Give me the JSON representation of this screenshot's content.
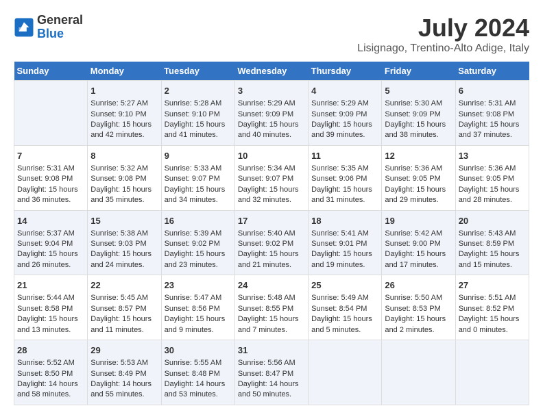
{
  "logo": {
    "line1": "General",
    "line2": "Blue"
  },
  "title": "July 2024",
  "subtitle": "Lisignago, Trentino-Alto Adige, Italy",
  "days_of_week": [
    "Sunday",
    "Monday",
    "Tuesday",
    "Wednesday",
    "Thursday",
    "Friday",
    "Saturday"
  ],
  "weeks": [
    [
      {
        "day": "",
        "content": ""
      },
      {
        "day": "1",
        "content": "Sunrise: 5:27 AM\nSunset: 9:10 PM\nDaylight: 15 hours\nand 42 minutes."
      },
      {
        "day": "2",
        "content": "Sunrise: 5:28 AM\nSunset: 9:10 PM\nDaylight: 15 hours\nand 41 minutes."
      },
      {
        "day": "3",
        "content": "Sunrise: 5:29 AM\nSunset: 9:09 PM\nDaylight: 15 hours\nand 40 minutes."
      },
      {
        "day": "4",
        "content": "Sunrise: 5:29 AM\nSunset: 9:09 PM\nDaylight: 15 hours\nand 39 minutes."
      },
      {
        "day": "5",
        "content": "Sunrise: 5:30 AM\nSunset: 9:09 PM\nDaylight: 15 hours\nand 38 minutes."
      },
      {
        "day": "6",
        "content": "Sunrise: 5:31 AM\nSunset: 9:08 PM\nDaylight: 15 hours\nand 37 minutes."
      }
    ],
    [
      {
        "day": "7",
        "content": "Sunrise: 5:31 AM\nSunset: 9:08 PM\nDaylight: 15 hours\nand 36 minutes."
      },
      {
        "day": "8",
        "content": "Sunrise: 5:32 AM\nSunset: 9:08 PM\nDaylight: 15 hours\nand 35 minutes."
      },
      {
        "day": "9",
        "content": "Sunrise: 5:33 AM\nSunset: 9:07 PM\nDaylight: 15 hours\nand 34 minutes."
      },
      {
        "day": "10",
        "content": "Sunrise: 5:34 AM\nSunset: 9:07 PM\nDaylight: 15 hours\nand 32 minutes."
      },
      {
        "day": "11",
        "content": "Sunrise: 5:35 AM\nSunset: 9:06 PM\nDaylight: 15 hours\nand 31 minutes."
      },
      {
        "day": "12",
        "content": "Sunrise: 5:36 AM\nSunset: 9:05 PM\nDaylight: 15 hours\nand 29 minutes."
      },
      {
        "day": "13",
        "content": "Sunrise: 5:36 AM\nSunset: 9:05 PM\nDaylight: 15 hours\nand 28 minutes."
      }
    ],
    [
      {
        "day": "14",
        "content": "Sunrise: 5:37 AM\nSunset: 9:04 PM\nDaylight: 15 hours\nand 26 minutes."
      },
      {
        "day": "15",
        "content": "Sunrise: 5:38 AM\nSunset: 9:03 PM\nDaylight: 15 hours\nand 24 minutes."
      },
      {
        "day": "16",
        "content": "Sunrise: 5:39 AM\nSunset: 9:02 PM\nDaylight: 15 hours\nand 23 minutes."
      },
      {
        "day": "17",
        "content": "Sunrise: 5:40 AM\nSunset: 9:02 PM\nDaylight: 15 hours\nand 21 minutes."
      },
      {
        "day": "18",
        "content": "Sunrise: 5:41 AM\nSunset: 9:01 PM\nDaylight: 15 hours\nand 19 minutes."
      },
      {
        "day": "19",
        "content": "Sunrise: 5:42 AM\nSunset: 9:00 PM\nDaylight: 15 hours\nand 17 minutes."
      },
      {
        "day": "20",
        "content": "Sunrise: 5:43 AM\nSunset: 8:59 PM\nDaylight: 15 hours\nand 15 minutes."
      }
    ],
    [
      {
        "day": "21",
        "content": "Sunrise: 5:44 AM\nSunset: 8:58 PM\nDaylight: 15 hours\nand 13 minutes."
      },
      {
        "day": "22",
        "content": "Sunrise: 5:45 AM\nSunset: 8:57 PM\nDaylight: 15 hours\nand 11 minutes."
      },
      {
        "day": "23",
        "content": "Sunrise: 5:47 AM\nSunset: 8:56 PM\nDaylight: 15 hours\nand 9 minutes."
      },
      {
        "day": "24",
        "content": "Sunrise: 5:48 AM\nSunset: 8:55 PM\nDaylight: 15 hours\nand 7 minutes."
      },
      {
        "day": "25",
        "content": "Sunrise: 5:49 AM\nSunset: 8:54 PM\nDaylight: 15 hours\nand 5 minutes."
      },
      {
        "day": "26",
        "content": "Sunrise: 5:50 AM\nSunset: 8:53 PM\nDaylight: 15 hours\nand 2 minutes."
      },
      {
        "day": "27",
        "content": "Sunrise: 5:51 AM\nSunset: 8:52 PM\nDaylight: 15 hours\nand 0 minutes."
      }
    ],
    [
      {
        "day": "28",
        "content": "Sunrise: 5:52 AM\nSunset: 8:50 PM\nDaylight: 14 hours\nand 58 minutes."
      },
      {
        "day": "29",
        "content": "Sunrise: 5:53 AM\nSunset: 8:49 PM\nDaylight: 14 hours\nand 55 minutes."
      },
      {
        "day": "30",
        "content": "Sunrise: 5:55 AM\nSunset: 8:48 PM\nDaylight: 14 hours\nand 53 minutes."
      },
      {
        "day": "31",
        "content": "Sunrise: 5:56 AM\nSunset: 8:47 PM\nDaylight: 14 hours\nand 50 minutes."
      },
      {
        "day": "",
        "content": ""
      },
      {
        "day": "",
        "content": ""
      },
      {
        "day": "",
        "content": ""
      }
    ]
  ]
}
